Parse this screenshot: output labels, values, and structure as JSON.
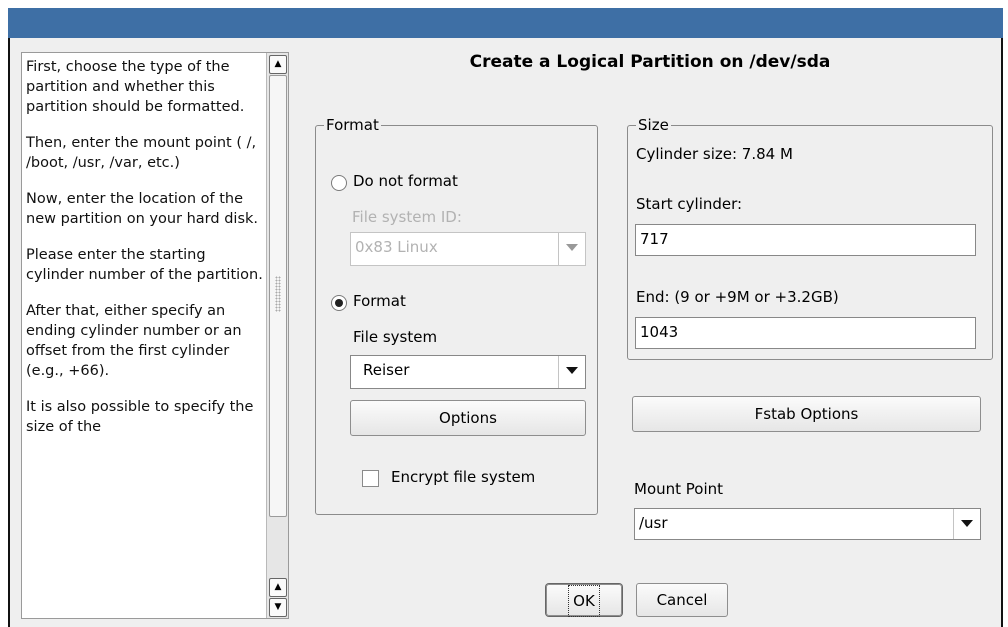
{
  "window": {
    "dialog_title": "Create a Logical Partition on /dev/sda"
  },
  "help": {
    "paragraphs": [
      "First, choose the type of the partition and whether this partition should be formatted.",
      "Then, enter the mount point ( /, /boot, /usr, /var, etc.)",
      "Now, enter the location of the new partition on your hard disk.",
      "Please enter the starting cylinder number of the partition.",
      "After that, either specify an ending cylinder number or an offset from the first cylinder (e.g., +66).",
      "It is also possible to specify the size of the"
    ]
  },
  "format_group": {
    "legend": "Format",
    "do_not_format_label": "Do not format",
    "fs_id_label": "File system ID:",
    "fs_id_value": "0x83 Linux",
    "format_label": "Format",
    "file_system_label": "File system",
    "file_system_value": "Reiser",
    "options_button": "Options",
    "encrypt_label": "Encrypt file system",
    "selected": "Format",
    "encrypt_checked": false
  },
  "size_group": {
    "legend": "Size",
    "cylinder_size": "Cylinder size: 7.84 M",
    "start_label": "Start cylinder:",
    "start_value": "717",
    "end_label": "End:  (9 or +9M or +3.2GB)",
    "end_value": "1043"
  },
  "fstab_button": "Fstab Options",
  "mount": {
    "label": "Mount Point",
    "value": "/usr"
  },
  "buttons": {
    "ok": "OK",
    "cancel": "Cancel"
  },
  "colors": {
    "titlebar": "#3e6fa5",
    "window_bg": "#efefef"
  }
}
